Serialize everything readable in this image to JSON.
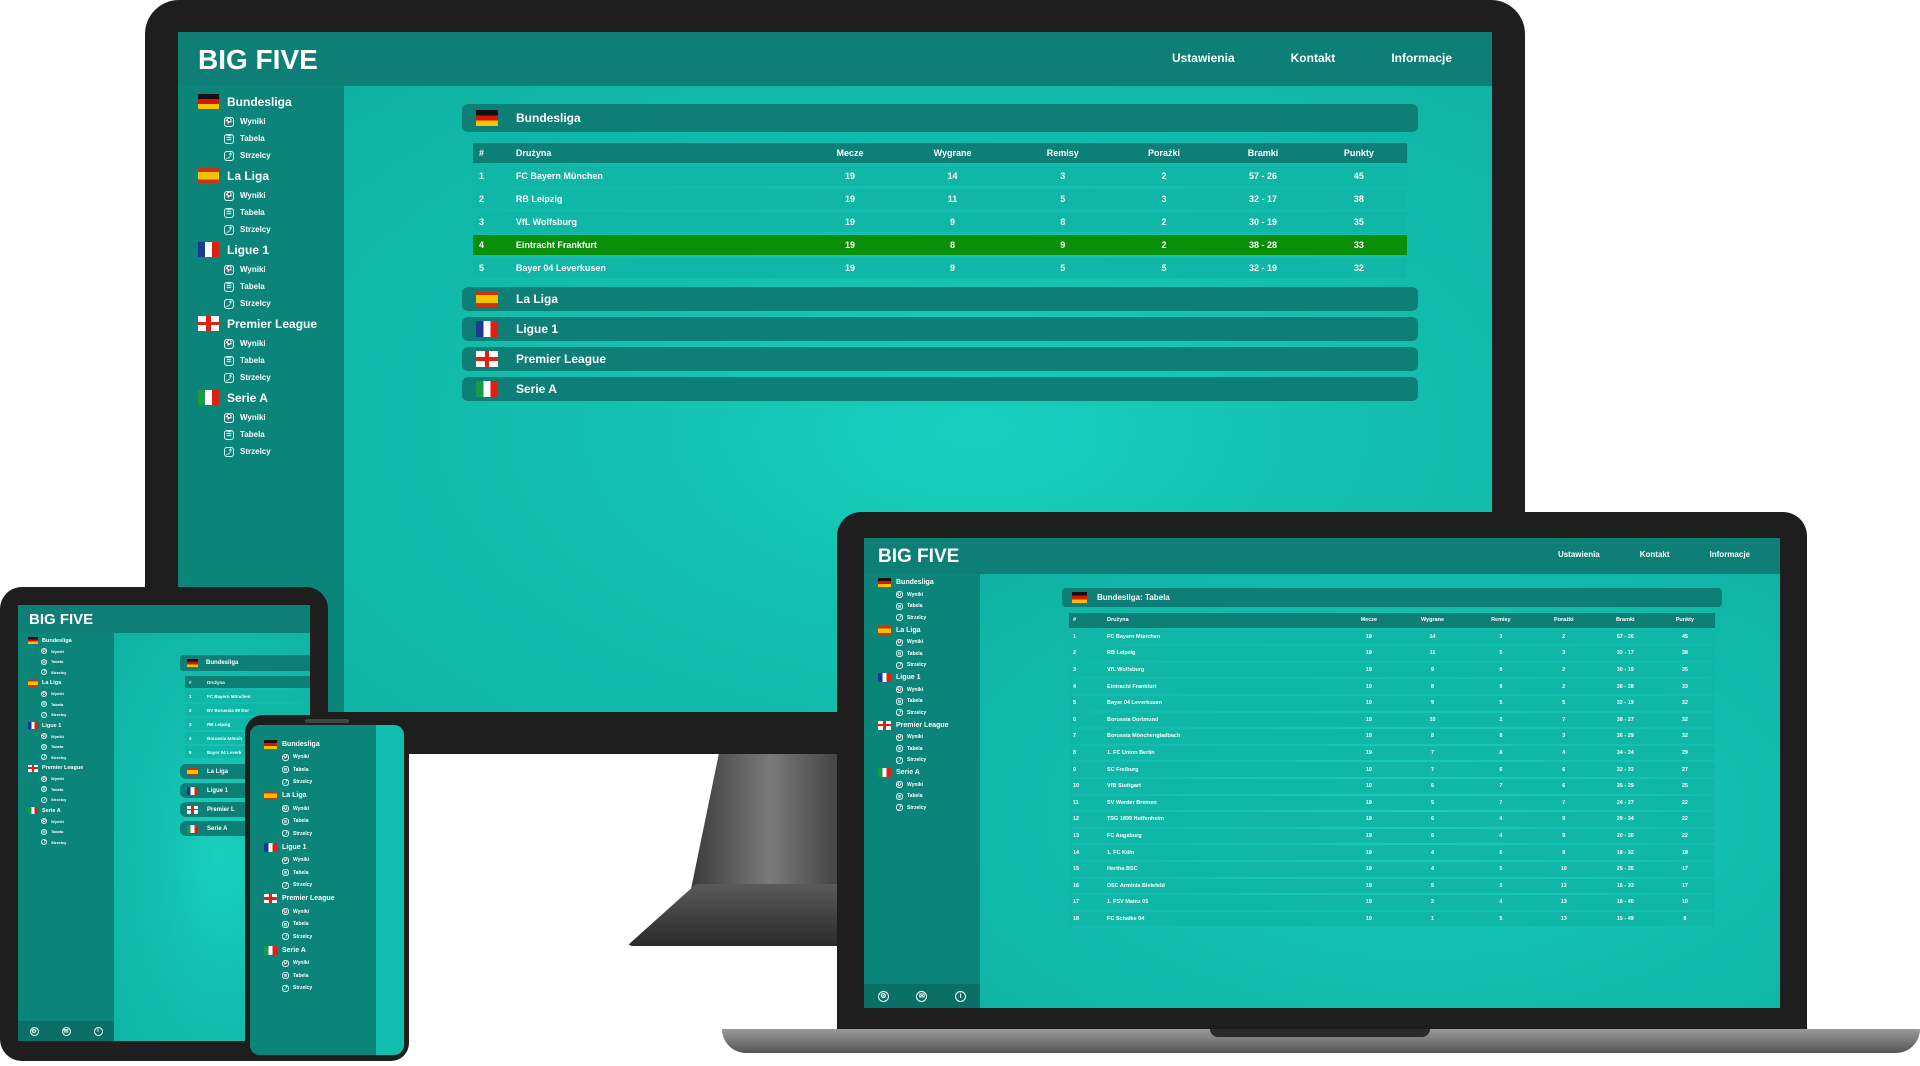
{
  "app": {
    "brand": "BIG FIVE",
    "nav": [
      "Ustawienia",
      "Kontakt",
      "Informacje"
    ],
    "leagues": [
      {
        "name": "Bundesliga",
        "flag": "de"
      },
      {
        "name": "La Liga",
        "flag": "es"
      },
      {
        "name": "Ligue 1",
        "flag": "fr"
      },
      {
        "name": "Premier League",
        "flag": "en"
      },
      {
        "name": "Serie A",
        "flag": "it"
      }
    ],
    "sub_items": [
      "Wyniki",
      "Tabela",
      "Strzelcy"
    ],
    "footer_icons": [
      "gear-icon",
      "mail-icon",
      "info-icon"
    ]
  },
  "monitor": {
    "open_league": "Bundesliga",
    "headers": [
      "#",
      "Drużyna",
      "Mecze",
      "Wygrane",
      "Remisy",
      "Porażki",
      "Bramki",
      "Punkty"
    ],
    "rows": [
      [
        "1",
        "FC Bayern München",
        "19",
        "14",
        "3",
        "2",
        "57 - 26",
        "45"
      ],
      [
        "2",
        "RB Leipzig",
        "19",
        "11",
        "5",
        "3",
        "32 - 17",
        "38"
      ],
      [
        "3",
        "VfL Wolfsburg",
        "19",
        "9",
        "8",
        "2",
        "30 - 19",
        "35"
      ],
      [
        "4",
        "Eintracht Frankfurt",
        "19",
        "8",
        "9",
        "2",
        "38 - 28",
        "33"
      ],
      [
        "5",
        "Bayer 04 Leverkusen",
        "19",
        "9",
        "5",
        "5",
        "32 - 19",
        "32"
      ]
    ],
    "highlight_row": 3,
    "collapsed": [
      "La Liga",
      "Ligue 1",
      "Premier League",
      "Serie A"
    ]
  },
  "laptop": {
    "title": "Bundesliga: Tabela",
    "headers": [
      "#",
      "Drużyna",
      "Mecze",
      "Wygrane",
      "Remisy",
      "Porażki",
      "Bramki",
      "Punkty"
    ],
    "rows": [
      [
        "1",
        "FC Bayern München",
        "19",
        "14",
        "3",
        "2",
        "57 - 26",
        "45"
      ],
      [
        "2",
        "RB Leipzig",
        "19",
        "11",
        "5",
        "3",
        "32 - 17",
        "38"
      ],
      [
        "3",
        "VfL Wolfsburg",
        "19",
        "9",
        "8",
        "2",
        "30 - 19",
        "35"
      ],
      [
        "4",
        "Eintracht Frankfurt",
        "19",
        "8",
        "9",
        "2",
        "38 - 28",
        "33"
      ],
      [
        "5",
        "Bayer 04 Leverkusen",
        "19",
        "9",
        "5",
        "5",
        "32 - 19",
        "32"
      ],
      [
        "6",
        "Borussia Dortmund",
        "19",
        "10",
        "2",
        "7",
        "38 - 27",
        "32"
      ],
      [
        "7",
        "Borussia Mönchengladbach",
        "19",
        "8",
        "8",
        "3",
        "36 - 29",
        "32"
      ],
      [
        "8",
        "1. FC Union Berlin",
        "19",
        "7",
        "8",
        "4",
        "34 - 24",
        "29"
      ],
      [
        "9",
        "SC Freiburg",
        "19",
        "7",
        "6",
        "6",
        "32 - 32",
        "27"
      ],
      [
        "10",
        "VfB Stuttgart",
        "19",
        "6",
        "7",
        "6",
        "35 - 29",
        "25"
      ],
      [
        "11",
        "SV Werder Bremen",
        "19",
        "5",
        "7",
        "7",
        "24 - 27",
        "22"
      ],
      [
        "12",
        "TSG 1899 Hoffenheim",
        "19",
        "6",
        "4",
        "9",
        "29 - 34",
        "22"
      ],
      [
        "13",
        "FC Augsburg",
        "19",
        "6",
        "4",
        "9",
        "20 - 30",
        "22"
      ],
      [
        "14",
        "1. FC Köln",
        "19",
        "4",
        "6",
        "9",
        "18 - 32",
        "18"
      ],
      [
        "15",
        "Hertha BSC",
        "19",
        "4",
        "5",
        "10",
        "25 - 35",
        "17"
      ],
      [
        "16",
        "DSC Arminia Bielefeld",
        "19",
        "5",
        "2",
        "12",
        "15 - 33",
        "17"
      ],
      [
        "17",
        "1. FSV Mainz 05",
        "19",
        "2",
        "4",
        "13",
        "18 - 40",
        "10"
      ],
      [
        "18",
        "FC Schalke 04",
        "19",
        "1",
        "5",
        "13",
        "15 - 49",
        "8"
      ]
    ]
  },
  "tablet": {
    "open_league": "Bundesliga",
    "header_cells": [
      "#",
      "Drużyna"
    ],
    "rows": [
      [
        "1",
        "FC Bayern München"
      ],
      [
        "2",
        "BV Borussia 09 Dor"
      ],
      [
        "3",
        "RB Leipzig"
      ],
      [
        "4",
        "Borussia Mönch"
      ],
      [
        "5",
        "Bayer 04 Leverk"
      ]
    ],
    "collapsed": [
      "La Liga",
      "Ligue 1",
      "Premier L",
      "Serie A"
    ]
  }
}
